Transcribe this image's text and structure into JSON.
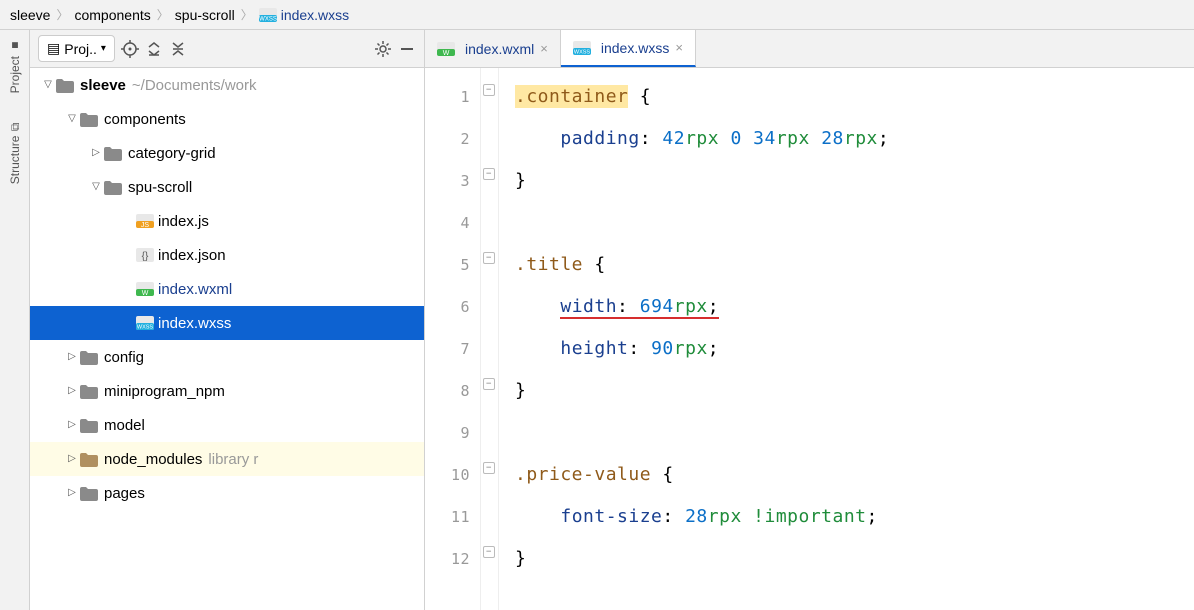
{
  "breadcrumb": [
    "sleeve",
    "components",
    "spu-scroll",
    "index.wxss"
  ],
  "sidebar_tabs": [
    "Project",
    "Structure"
  ],
  "project_label": "Proj..",
  "tree": {
    "root": {
      "name": "sleeve",
      "path": "~/Documents/work"
    },
    "n0": "components",
    "n1": "category-grid",
    "n2": "spu-scroll",
    "n3": "index.js",
    "n4": "index.json",
    "n5": "index.wxml",
    "n6": "index.wxss",
    "n7": "config",
    "n8": "miniprogram_npm",
    "n9": "model",
    "n10": "node_modules",
    "n10m": "library r",
    "n11": "pages"
  },
  "tabs": [
    {
      "label": "index.wxml",
      "type": "wxml"
    },
    {
      "label": "index.wxss",
      "type": "wxss"
    }
  ],
  "code": {
    "l1": {
      "sel": ".container",
      "b": "{"
    },
    "l2": {
      "prop": "padding",
      "v": [
        {
          "t": "num",
          "v": "42"
        },
        {
          "t": "unit",
          "v": "rpx"
        },
        {
          "t": "sp",
          "v": " "
        },
        {
          "t": "num",
          "v": "0"
        },
        {
          "t": "sp",
          "v": " "
        },
        {
          "t": "num",
          "v": "34"
        },
        {
          "t": "unit",
          "v": "rpx"
        },
        {
          "t": "sp",
          "v": " "
        },
        {
          "t": "num",
          "v": "28"
        },
        {
          "t": "unit",
          "v": "rpx"
        }
      ]
    },
    "l3": "}",
    "l5": {
      "sel": ".title",
      "b": "{"
    },
    "l6": {
      "prop": "width",
      "v": [
        {
          "t": "num",
          "v": "694"
        },
        {
          "t": "unit",
          "v": "rpx"
        }
      ],
      "err": true
    },
    "l7": {
      "prop": "height",
      "v": [
        {
          "t": "num",
          "v": "90"
        },
        {
          "t": "unit",
          "v": "rpx"
        }
      ]
    },
    "l8": "}",
    "l10": {
      "sel": ".price-value",
      "b": "{"
    },
    "l11": {
      "prop": "font-size",
      "v": [
        {
          "t": "num",
          "v": "28"
        },
        {
          "t": "unit",
          "v": "rpx"
        },
        {
          "t": "sp",
          "v": " "
        },
        {
          "t": "imp",
          "v": "!important"
        }
      ]
    },
    "l12": "}"
  },
  "icons": {
    "js": "JS",
    "wxml": "W",
    "wxss": "WXSS",
    "json": "{}",
    "close": "×"
  }
}
